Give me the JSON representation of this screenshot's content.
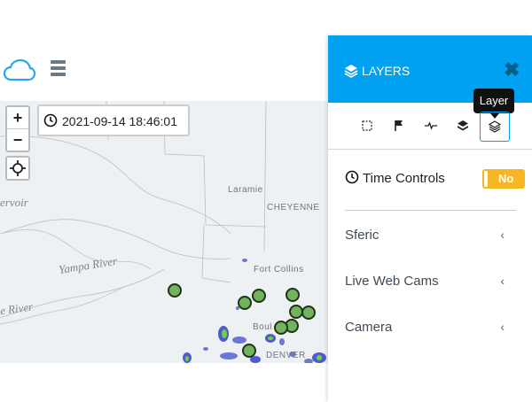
{
  "header": {
    "cloud_icon": "cloud-icon",
    "menu_icon": "hamburger-icon"
  },
  "map": {
    "zoom_in": "+",
    "zoom_out": "−",
    "timestamp": "2021-09-14 18:46:01",
    "labels": {
      "laramie": "Laramie",
      "cheyenne": "CHEYENNE",
      "fort_collins": "Fort Collins",
      "boulder": "Boul",
      "denver": "DENVER",
      "reservoir": "ervoir",
      "yampa": "Yampa River",
      "river": "e River"
    }
  },
  "panel": {
    "title": "LAYERS",
    "close": "✖",
    "tooltip": "Layer",
    "tools": [
      "select-box-icon",
      "flag-icon",
      "pulse-icon",
      "stacked-layers-icon",
      "layers-outline-icon"
    ],
    "time_controls": {
      "label": "Time Controls",
      "toggle": "No"
    },
    "items": [
      {
        "label": "Sferic"
      },
      {
        "label": "Live Web Cams"
      },
      {
        "label": "Camera"
      }
    ]
  },
  "colors": {
    "accent": "#00a1f1",
    "toggle": "#f7b624",
    "marker": "#73b35d"
  }
}
